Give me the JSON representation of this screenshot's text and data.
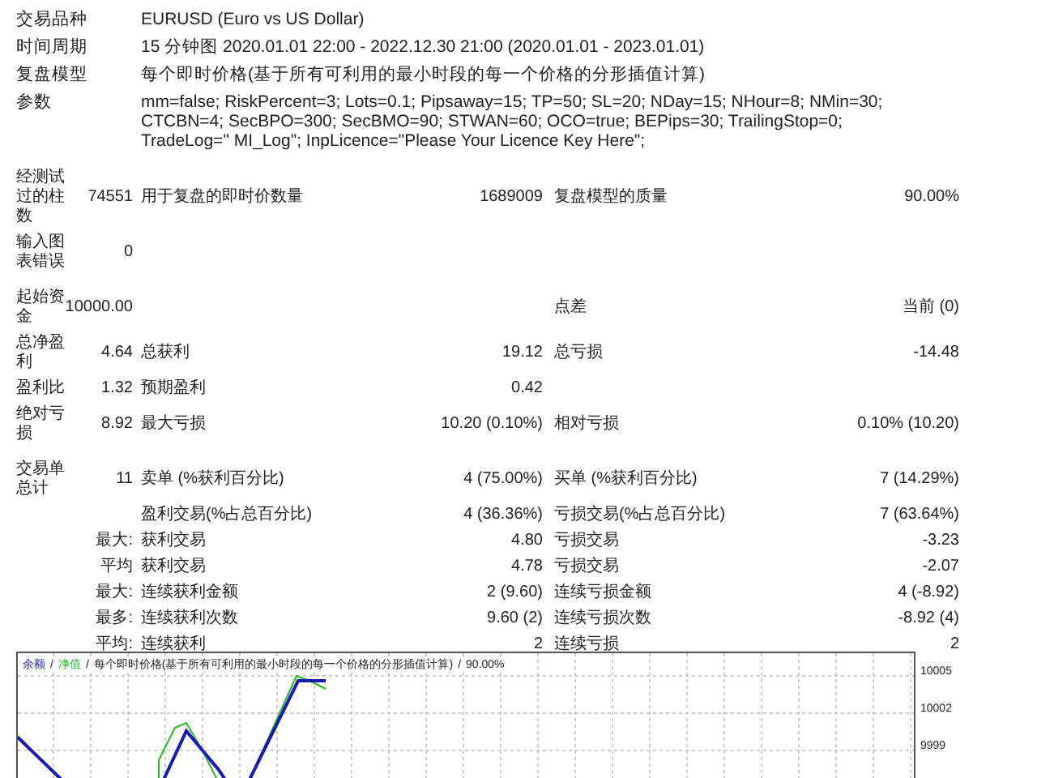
{
  "header": [
    {
      "label": "交易品种",
      "value": "EURUSD (Euro vs US Dollar)"
    },
    {
      "label": "时间周期",
      "value": "15 分钟图 2020.01.01 22:00 - 2022.12.30 21:00 (2020.01.01 - 2023.01.01)"
    },
    {
      "label": "复盘模型",
      "value": "每个即时价格(基于所有可利用的最小时段的每一个价格的分形插值计算)"
    },
    {
      "label": "参数",
      "value": "mm=false; RiskPercent=3; Lots=0.1; Pipsaway=15; TP=50; SL=20; NDay=15; NHour=8; NMin=30; CTCBN=4; SecBPO=300; SecBMO=90; STWAN=60; OCO=true; BEPips=30; TrailingStop=0; TradeLog=\" MI_Log\"; InpLicence=\"Please Your Licence Key Here\";"
    }
  ],
  "sections": [
    {
      "rows": [
        {
          "label": "经测试过的柱数",
          "value": "74551",
          "label_2": "用于复盘的即时价数量",
          "value_2": "1689009",
          "label_3": "复盘模型的质量",
          "value_3": "90.00%"
        },
        {
          "label": "输入图表错误",
          "value": "0"
        }
      ]
    },
    {
      "rows": [
        {
          "label": "起始资金",
          "value": "10000.00",
          "label_3": "点差",
          "value_3": "当前 (0)"
        },
        {
          "label": "总净盈利",
          "value": "4.64",
          "label_2": "总获利",
          "value_2": "19.12",
          "label_3": "总亏损",
          "value_3": "-14.48"
        },
        {
          "label": "盈利比",
          "value": "1.32",
          "label_2": "预期盈利",
          "value_2": "0.42"
        },
        {
          "label": "绝对亏损",
          "value": "8.92",
          "label_2": "最大亏损",
          "value_2": "10.20 (0.10%)",
          "label_3": "相对亏损",
          "value_3": "0.10% (10.20)"
        }
      ]
    },
    {
      "rows": [
        {
          "label": "交易单总计",
          "value": "11",
          "label_2": "卖单 (%获利百分比)",
          "value_2": "4 (75.00%)",
          "label_3": "买单 (%获利百分比)",
          "value_3": "7 (14.29%)"
        },
        {
          "label_2": "盈利交易(%占总百分比)",
          "value_2": "4 (36.36%)",
          "label_3": "亏损交易(%占总百分比)",
          "value_3": "7 (63.64%)"
        },
        {
          "value": "最大:",
          "label_2": "获利交易",
          "value_2": "4.80",
          "label_3": "亏损交易",
          "value_3": "-3.23"
        },
        {
          "value": "平均",
          "label_2": "获利交易",
          "value_2": "4.78",
          "label_3": "亏损交易",
          "value_3": "-2.07"
        },
        {
          "value": "最大:",
          "label_2": "连续获利金额",
          "value_2": "2 (9.60)",
          "label_3": "连续亏损金额",
          "value_3": "4 (-8.92)"
        },
        {
          "value": "最多:",
          "label_2": "连续获利次数",
          "value_2": "9.60 (2)",
          "label_3": "连续亏损次数",
          "value_3": "-8.92 (4)"
        },
        {
          "value": "平均:",
          "label_2": "连续获利",
          "value_2": "2",
          "label_3": "连续亏损",
          "value_3": "2"
        }
      ]
    }
  ],
  "chart": {
    "legend": [
      {
        "text": "余额",
        "color": "#1a1ab0"
      },
      {
        "text": "/"
      },
      {
        "text": "净值",
        "color": "#22bb22"
      },
      {
        "text": "/"
      },
      {
        "text": "每个即时价格(基于所有可利用的最小时段的每一个价格的分形插值计算)"
      },
      {
        "text": "/"
      },
      {
        "text": "90.00%"
      }
    ],
    "y_labels": [
      "10005",
      "10002",
      "9999"
    ]
  }
}
